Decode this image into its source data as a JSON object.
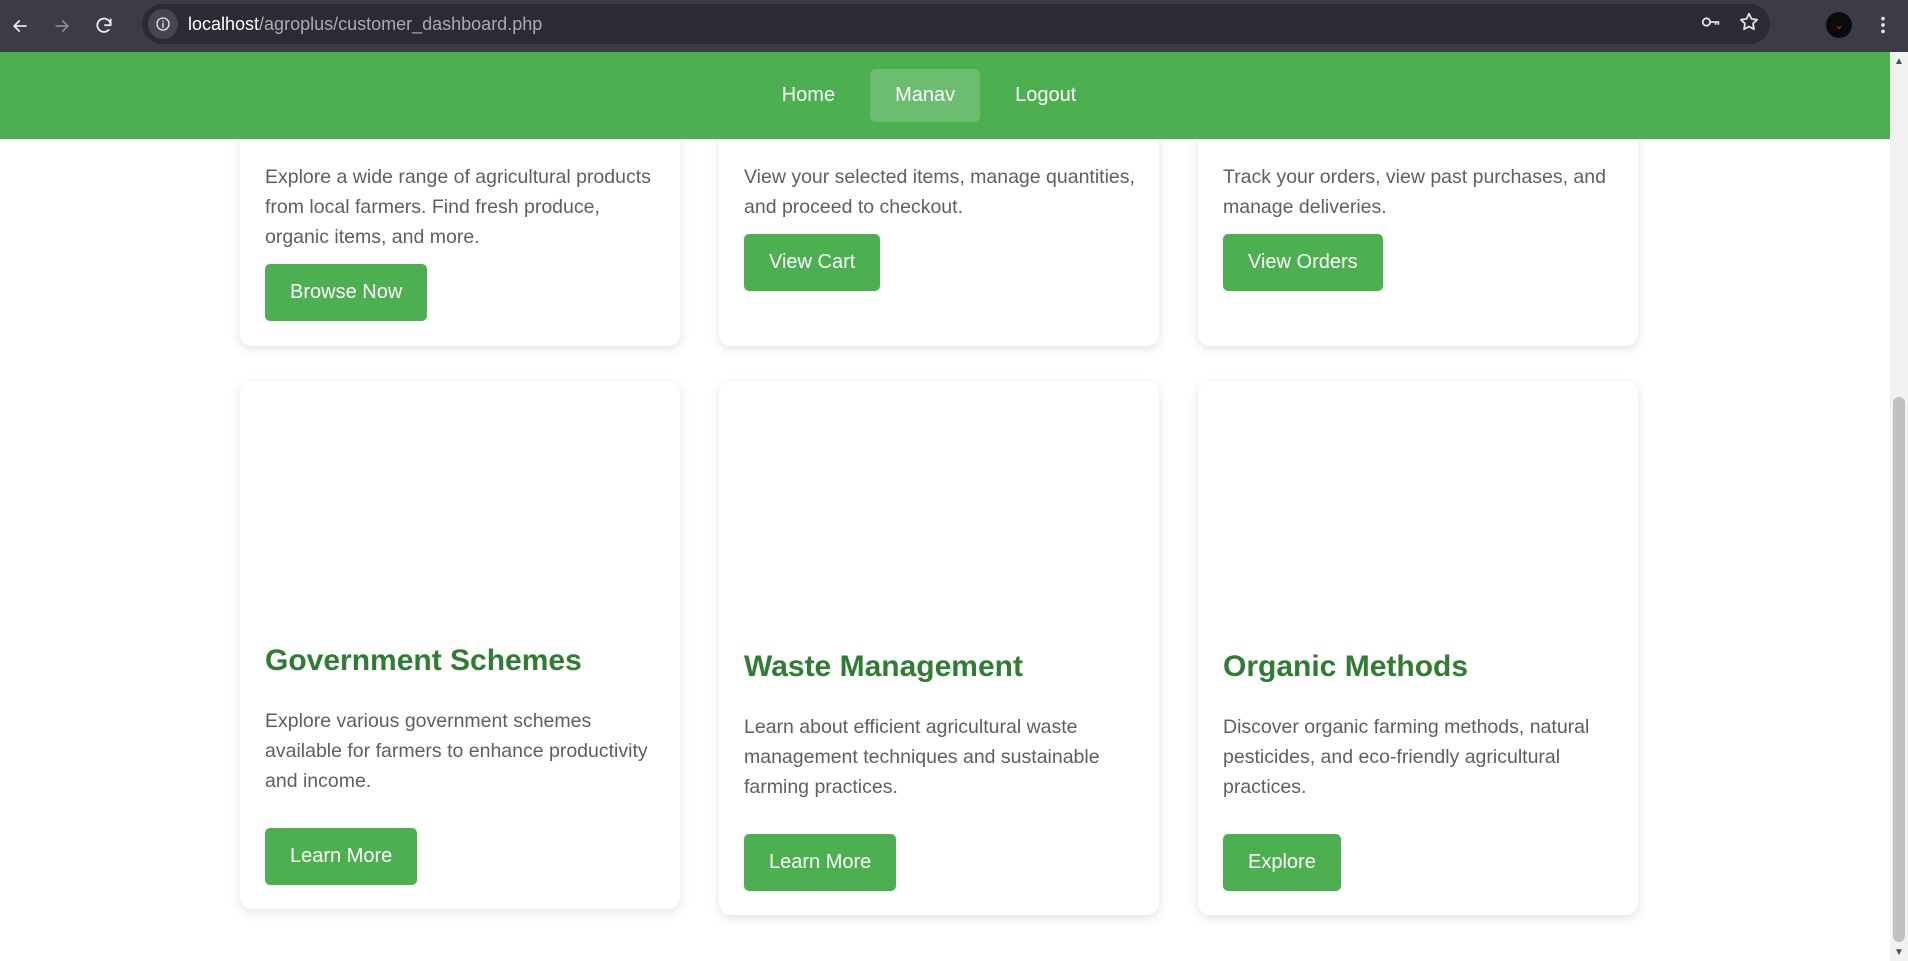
{
  "browser": {
    "url_host": "localhost",
    "url_path": "/agroplus/customer_dashboard.php"
  },
  "nav": {
    "items": [
      {
        "label": "Home"
      },
      {
        "label": "Manav"
      },
      {
        "label": "Logout"
      }
    ]
  },
  "cards": [
    {
      "description": "Explore a wide range of agricultural products from local farmers. Find fresh produce, organic items, and more.",
      "button": "Browse Now"
    },
    {
      "description": "View your selected items, manage quantities, and proceed to checkout.",
      "button": "View Cart"
    },
    {
      "description": "Track your orders, view past purchases, and manage deliveries.",
      "button": "View Orders"
    },
    {
      "title": "Government Schemes",
      "description": "Explore various government schemes available for farmers to enhance productivity and income.",
      "button": "Learn More"
    },
    {
      "title": "Waste Management",
      "description": "Learn about efficient agricultural waste management techniques and sustainable farming practices.",
      "button": "Learn More"
    },
    {
      "title": "Organic Methods",
      "description": "Discover organic farming methods, natural pesticides, and eco-friendly agricultural practices.",
      "button": "Explore"
    }
  ],
  "colors": {
    "accent": "#4caf50",
    "title": "#2e7d32",
    "chrome": "#3b3c46"
  }
}
